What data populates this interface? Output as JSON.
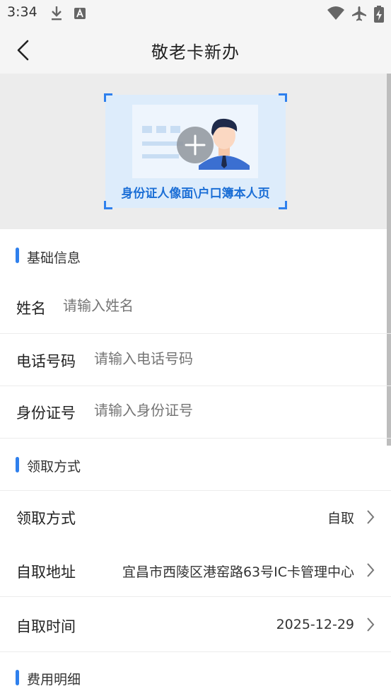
{
  "status_bar": {
    "time": "3:34",
    "icons": [
      "download-icon",
      "a-notification-icon",
      "wifi-icon",
      "airplane-icon",
      "battery-charging-icon"
    ]
  },
  "header": {
    "title": "敬老卡新办",
    "back_icon": "chevron-left-icon"
  },
  "upload": {
    "caption": "身份证人像面\\户口簿本人页",
    "icon": "add-photo-icon",
    "accent": "#2f80ed"
  },
  "sections": {
    "basic_info": {
      "title": "基础信息",
      "name": {
        "label": "姓名",
        "placeholder": "请输入姓名"
      },
      "phone": {
        "label": "电话号码",
        "placeholder": "请输入电话号码"
      },
      "id_number": {
        "label": "身份证号",
        "placeholder": "请输入身份证号"
      }
    },
    "pickup": {
      "title": "领取方式",
      "method": {
        "label": "领取方式",
        "value": "自取"
      },
      "address": {
        "label": "自取地址",
        "value": "宜昌市西陵区港窑路63号IC卡管理中心"
      },
      "time": {
        "label": "自取时间",
        "value": "2025-12-29"
      }
    },
    "fees": {
      "title": "费用明细"
    }
  }
}
